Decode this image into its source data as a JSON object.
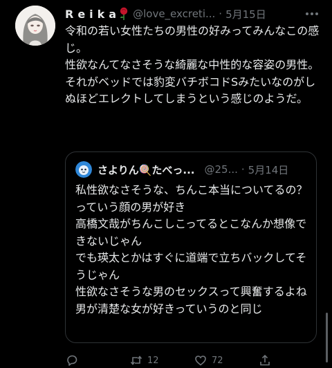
{
  "tweet": {
    "display_name": "Reika",
    "handle": "@love_excreti...",
    "separator": "·",
    "date": "5月15日",
    "text": "令和の若い女性たちの男性の好みってみんなこの感じ。\n性欲なんてなさそうな綺麗な中性的な容姿の男性。\nそれがベッドでは豹変バチボコドSみたいなのがしぬほどエレクトしてしまうという感じのようだ。"
  },
  "quote": {
    "display_name": "さよりん🍭たべっ...",
    "handle": "@25...",
    "separator": "·",
    "date": "5月14日",
    "text": "私性欲なさそうな、ちんこ本当についてるの？っていう顔の男が好き\n高橋文哉がちんこしこってるとこなんか想像できないじゃん\nでも瑛太とかはすぐに道端で立ちバックしてそうじゃん\n性欲なさそうな男のセックスって興奮するよね\n男が清楚な女が好きっていうのと同じ"
  },
  "actions": {
    "replies": "",
    "retweets": "12",
    "likes": "72"
  },
  "colors": {
    "background": "#000000",
    "text": "#e7e9ea",
    "muted": "#71767b",
    "border": "#2f3336"
  },
  "icons": [
    "avatar",
    "rose-icon",
    "more-icon",
    "quote-avatar",
    "lollipop-icon",
    "reply-icon",
    "retweet-icon",
    "like-icon",
    "share-icon"
  ]
}
